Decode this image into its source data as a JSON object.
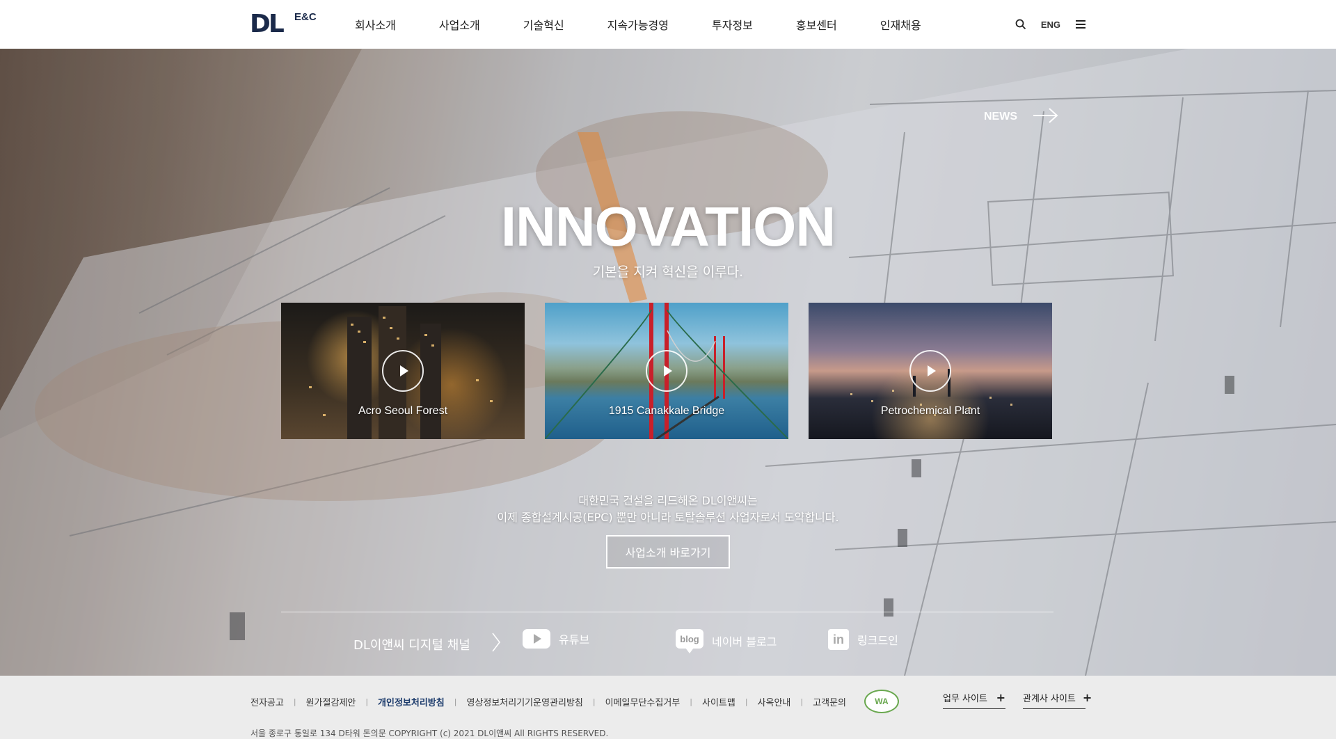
{
  "header": {
    "logo_mark": "DL",
    "logo_sub": "E&C",
    "nav": [
      "회사소개",
      "사업소개",
      "기술혁신",
      "지속가능경영",
      "투자정보",
      "홍보센터",
      "인재채용"
    ],
    "lang": "ENG",
    "icons": [
      "search-icon",
      "menu-icon"
    ]
  },
  "hero": {
    "news_label": "NEWS",
    "title": "INNOVATION",
    "subtitle": "기본을 지켜 혁신을 이루다.",
    "cards": [
      {
        "label": "Acro Seoul Forest",
        "icon": "play-icon"
      },
      {
        "label": "1915 Canakkale Bridge",
        "icon": "play-icon"
      },
      {
        "label": "Petrochemical Plant",
        "icon": "play-icon"
      }
    ],
    "desc_line1": "대한민국 건설을 리드해온 DL이앤씨는",
    "desc_line2": "이제 종합설계시공(EPC) 뿐만 아니라 토탈솔루션 사업자로서 도약합니다.",
    "cta": "사업소개 바로가기"
  },
  "channels": {
    "title": "DL이앤씨 디지털 채널",
    "youtube": "유튜브",
    "blog_badge": "blog",
    "blog": "네이버 블로그",
    "linkedin_badge": "in",
    "linkedin": "링크드인"
  },
  "footer": {
    "links": [
      "전자공고",
      "원가절감제안",
      "개인정보처리방침",
      "영상정보처리기기운영관리방침",
      "이메일무단수집거부",
      "사이트맵",
      "사옥안내",
      "고객문의"
    ],
    "wa_badge": "WA",
    "site_1": "업무 사이트",
    "site_2": "관계사 사이트",
    "plus": "+",
    "copyright": "서울 종로구 통일로 134 D타워 돈의문 COPYRIGHT (c) 2021 DL이앤씨 All RIGHTS RESERVED."
  },
  "colors": {
    "brand_navy": "#1b2a4a",
    "footer_bg": "#ececec",
    "highlight_link": "#1b3a6b"
  }
}
